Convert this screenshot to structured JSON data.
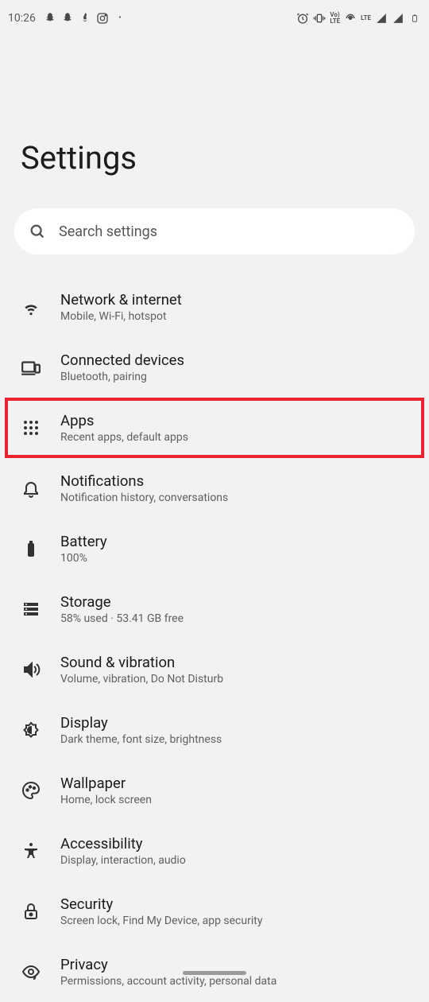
{
  "status_bar": {
    "time": "10:26",
    "lte_label": "LTE",
    "volte_label": "Vo)\nLTE"
  },
  "page": {
    "title": "Settings",
    "search_placeholder": "Search settings"
  },
  "items": [
    {
      "title": "Network & internet",
      "subtitle": "Mobile, Wi-Fi, hotspot",
      "icon": "wifi-icon",
      "highlighted": false
    },
    {
      "title": "Connected devices",
      "subtitle": "Bluetooth, pairing",
      "icon": "devices-icon",
      "highlighted": false
    },
    {
      "title": "Apps",
      "subtitle": "Recent apps, default apps",
      "icon": "apps-icon",
      "highlighted": true
    },
    {
      "title": "Notifications",
      "subtitle": "Notification history, conversations",
      "icon": "bell-icon",
      "highlighted": false
    },
    {
      "title": "Battery",
      "subtitle": "100%",
      "icon": "battery-icon",
      "highlighted": false
    },
    {
      "title": "Storage",
      "subtitle": "58% used · 53.41 GB free",
      "icon": "storage-icon",
      "highlighted": false
    },
    {
      "title": "Sound & vibration",
      "subtitle": "Volume, vibration, Do Not Disturb",
      "icon": "sound-icon",
      "highlighted": false
    },
    {
      "title": "Display",
      "subtitle": "Dark theme, font size, brightness",
      "icon": "brightness-icon",
      "highlighted": false
    },
    {
      "title": "Wallpaper",
      "subtitle": "Home, lock screen",
      "icon": "palette-icon",
      "highlighted": false
    },
    {
      "title": "Accessibility",
      "subtitle": "Display, interaction, audio",
      "icon": "accessibility-icon",
      "highlighted": false
    },
    {
      "title": "Security",
      "subtitle": "Screen lock, Find My Device, app security",
      "icon": "lock-icon",
      "highlighted": false
    },
    {
      "title": "Privacy",
      "subtitle": "Permissions, account activity, personal data",
      "icon": "privacy-icon",
      "highlighted": false
    }
  ]
}
